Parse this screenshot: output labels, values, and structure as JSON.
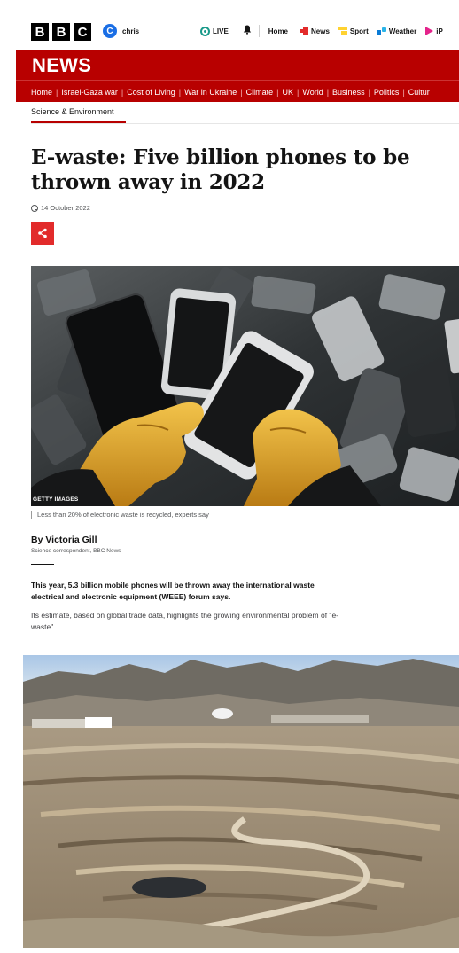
{
  "masthead": {
    "logo_letters": [
      "B",
      "B",
      "C"
    ],
    "account": {
      "initial": "C",
      "name": "chris"
    },
    "nav": [
      {
        "label": "LIVE",
        "icon": "live-icon"
      },
      {
        "label": "",
        "icon": "bell-icon"
      },
      {
        "label": "Home",
        "icon": ""
      },
      {
        "label": "News",
        "icon": "news-icon"
      },
      {
        "label": "Sport",
        "icon": "sport-icon"
      },
      {
        "label": "Weather",
        "icon": "weather-icon"
      },
      {
        "label": "iP",
        "icon": "iplayer-icon"
      }
    ]
  },
  "news": {
    "title": "NEWS",
    "nav": [
      "Home",
      "Israel-Gaza war",
      "Cost of Living",
      "War in Ukraine",
      "Climate",
      "UK",
      "World",
      "Business",
      "Politics",
      "Cultur"
    ]
  },
  "article": {
    "section": "Science & Environment",
    "headline": "E-waste: Five billion phones to be thrown away in 2022",
    "date": "14 October 2022",
    "hero_credit": "GETTY IMAGES",
    "hero_caption": "Less than 20% of electronic waste is recycled, experts say",
    "author": "By Victoria Gill",
    "author_role": "Science correspondent, BBC News",
    "lede": "This year, 5.3 billion mobile phones will be thrown away the international waste electrical and electronic equipment (WEEE) forum says.",
    "paragraph": "Its estimate, based on global trade data, highlights the growing environmental problem of \"e-waste\"."
  },
  "colors": {
    "bbc_red": "#b80000",
    "share_red": "#e22b2b",
    "live_teal": "#1a9a8a"
  }
}
